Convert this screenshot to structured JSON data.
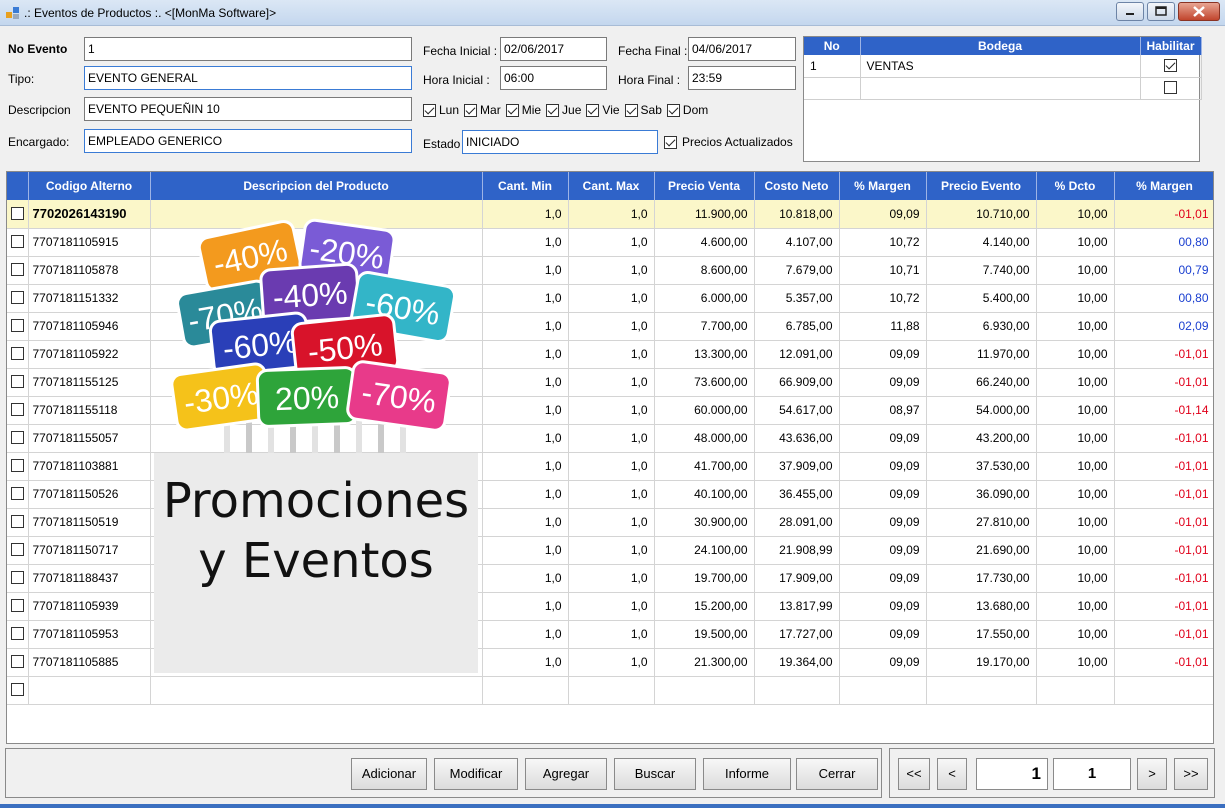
{
  "window": {
    "title": ".: Eventos de Productos :. <[MonMa Software]>"
  },
  "form": {
    "no_evento_label": "No Evento",
    "no_evento_value": "1",
    "tipo_label": "Tipo:",
    "tipo_value": "EVENTO GENERAL",
    "descripcion_label": "Descripcion",
    "descripcion_value": "EVENTO PEQUEÑIN 10",
    "encargado_label": "Encargado:",
    "encargado_value": "EMPLEADO GENERICO",
    "fecha_inicial_label": "Fecha Inicial :",
    "fecha_inicial_value": "02/06/2017",
    "fecha_final_label": "Fecha Final :",
    "fecha_final_value": "04/06/2017",
    "hora_inicial_label": "Hora Inicial :",
    "hora_inicial_value": "06:00",
    "hora_final_label": "Hora Final :",
    "hora_final_value": "23:59",
    "days": [
      {
        "label": "Lun",
        "checked": true
      },
      {
        "label": "Mar",
        "checked": true
      },
      {
        "label": "Mie",
        "checked": true
      },
      {
        "label": "Jue",
        "checked": true
      },
      {
        "label": "Vie",
        "checked": true
      },
      {
        "label": "Sab",
        "checked": true
      },
      {
        "label": "Dom",
        "checked": true
      }
    ],
    "estado_label": "Estado",
    "estado_value": "INICIADO",
    "precios_label": "Precios Actualizados",
    "precios_checked": true
  },
  "bodega": {
    "headers": [
      "No",
      "Bodega",
      "Habilitar"
    ],
    "rows": [
      {
        "no": "1",
        "bodega": "VENTAS",
        "habilitar": true
      },
      {
        "no": "",
        "bodega": "",
        "habilitar": false
      }
    ]
  },
  "grid": {
    "headers": [
      "",
      "Codigo Alterno",
      "Descripcion del Producto",
      "Cant. Min",
      "Cant. Max",
      "Precio Venta",
      "Costo Neto",
      "% Margen",
      "Precio Evento",
      "% Dcto",
      "% Margen"
    ],
    "rows": [
      {
        "code": "7702026143190",
        "min": "1,0",
        "max": "1,0",
        "venta": "11.900,00",
        "costo": "10.818,00",
        "margen": "09,09",
        "evento": "10.710,00",
        "dcto": "10,00",
        "margen2": "-01,01",
        "tone": "red"
      },
      {
        "code": "7707181105915",
        "min": "1,0",
        "max": "1,0",
        "venta": "4.600,00",
        "costo": "4.107,00",
        "margen": "10,72",
        "evento": "4.140,00",
        "dcto": "10,00",
        "margen2": "00,80",
        "tone": "blue"
      },
      {
        "code": "7707181105878",
        "min": "1,0",
        "max": "1,0",
        "venta": "8.600,00",
        "costo": "7.679,00",
        "margen": "10,71",
        "evento": "7.740,00",
        "dcto": "10,00",
        "margen2": "00,79",
        "tone": "blue"
      },
      {
        "code": "7707181151332",
        "min": "1,0",
        "max": "1,0",
        "venta": "6.000,00",
        "costo": "5.357,00",
        "margen": "10,72",
        "evento": "5.400,00",
        "dcto": "10,00",
        "margen2": "00,80",
        "tone": "blue"
      },
      {
        "code": "7707181105946",
        "min": "1,0",
        "max": "1,0",
        "venta": "7.700,00",
        "costo": "6.785,00",
        "margen": "11,88",
        "evento": "6.930,00",
        "dcto": "10,00",
        "margen2": "02,09",
        "tone": "blue"
      },
      {
        "code": "7707181105922",
        "min": "1,0",
        "max": "1,0",
        "venta": "13.300,00",
        "costo": "12.091,00",
        "margen": "09,09",
        "evento": "11.970,00",
        "dcto": "10,00",
        "margen2": "-01,01",
        "tone": "red"
      },
      {
        "code": "7707181155125",
        "min": "1,0",
        "max": "1,0",
        "venta": "73.600,00",
        "costo": "66.909,00",
        "margen": "09,09",
        "evento": "66.240,00",
        "dcto": "10,00",
        "margen2": "-01,01",
        "tone": "red"
      },
      {
        "code": "7707181155118",
        "min": "1,0",
        "max": "1,0",
        "venta": "60.000,00",
        "costo": "54.617,00",
        "margen": "08,97",
        "evento": "54.000,00",
        "dcto": "10,00",
        "margen2": "-01,14",
        "tone": "red"
      },
      {
        "code": "7707181155057",
        "min": "1,0",
        "max": "1,0",
        "venta": "48.000,00",
        "costo": "43.636,00",
        "margen": "09,09",
        "evento": "43.200,00",
        "dcto": "10,00",
        "margen2": "-01,01",
        "tone": "red"
      },
      {
        "code": "7707181103881",
        "min": "1,0",
        "max": "1,0",
        "venta": "41.700,00",
        "costo": "37.909,00",
        "margen": "09,09",
        "evento": "37.530,00",
        "dcto": "10,00",
        "margen2": "-01,01",
        "tone": "red"
      },
      {
        "code": "7707181150526",
        "min": "1,0",
        "max": "1,0",
        "venta": "40.100,00",
        "costo": "36.455,00",
        "margen": "09,09",
        "evento": "36.090,00",
        "dcto": "10,00",
        "margen2": "-01,01",
        "tone": "red"
      },
      {
        "code": "7707181150519",
        "min": "1,0",
        "max": "1,0",
        "venta": "30.900,00",
        "costo": "28.091,00",
        "margen": "09,09",
        "evento": "27.810,00",
        "dcto": "10,00",
        "margen2": "-01,01",
        "tone": "red"
      },
      {
        "code": "7707181150717",
        "min": "1,0",
        "max": "1,0",
        "venta": "24.100,00",
        "costo": "21.908,99",
        "margen": "09,09",
        "evento": "21.690,00",
        "dcto": "10,00",
        "margen2": "-01,01",
        "tone": "red"
      },
      {
        "code": "7707181188437",
        "min": "1,0",
        "max": "1,0",
        "venta": "19.700,00",
        "costo": "17.909,00",
        "margen": "09,09",
        "evento": "17.730,00",
        "dcto": "10,00",
        "margen2": "-01,01",
        "tone": "red"
      },
      {
        "code": "7707181105939",
        "min": "1,0",
        "max": "1,0",
        "venta": "15.200,00",
        "costo": "13.817,99",
        "margen": "09,09",
        "evento": "13.680,00",
        "dcto": "10,00",
        "margen2": "-01,01",
        "tone": "red"
      },
      {
        "code": "7707181105953",
        "min": "1,0",
        "max": "1,0",
        "venta": "19.500,00",
        "costo": "17.727,00",
        "margen": "09,09",
        "evento": "17.550,00",
        "dcto": "10,00",
        "margen2": "-01,01",
        "tone": "red"
      },
      {
        "code": "7707181105885",
        "min": "1,0",
        "max": "1,0",
        "venta": "21.300,00",
        "costo": "19.364,00",
        "margen": "09,09",
        "evento": "19.170,00",
        "dcto": "10,00",
        "margen2": "-01,01",
        "tone": "red"
      }
    ]
  },
  "promo": {
    "line1": "Promociones",
    "line2": "y Eventos",
    "signs": [
      {
        "text": "-40%",
        "color": "#f39a1e"
      },
      {
        "text": "-20%",
        "color": "#7a5bd6"
      },
      {
        "text": "-70%",
        "color": "#2a8a99"
      },
      {
        "text": "-40%",
        "color": "#6a3bb0"
      },
      {
        "text": "-60%",
        "color": "#33b5c8"
      },
      {
        "text": "-60%",
        "color": "#2a3fb8"
      },
      {
        "text": "-50%",
        "color": "#d8132a"
      },
      {
        "text": "-30%",
        "color": "#f5c21a"
      },
      {
        "text": "20%",
        "color": "#2ea43a"
      },
      {
        "text": "-70%",
        "color": "#e83a8a"
      }
    ]
  },
  "actions": {
    "adicionar": "Adicionar",
    "modificar": "Modificar",
    "agregar": "Agregar",
    "buscar": "Buscar",
    "informe": "Informe",
    "cerrar": "Cerrar"
  },
  "nav": {
    "first": "<<",
    "prev": "<",
    "page_input": "1",
    "page_total": "1",
    "next": ">",
    "last": ">>"
  }
}
